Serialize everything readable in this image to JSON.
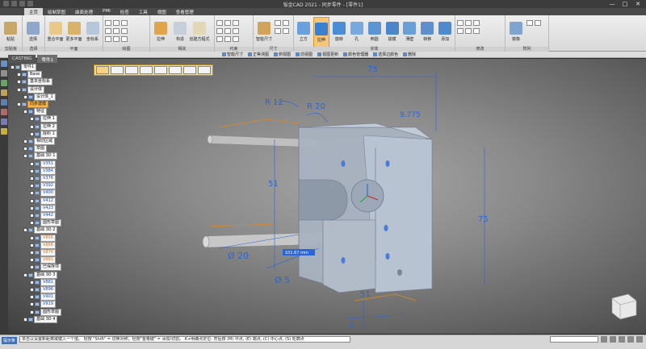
{
  "app": {
    "title": "钣金CAD 2021 - 同步零件 - [零件1]",
    "window_controls": [
      "—",
      "□",
      "✕"
    ]
  },
  "ribbon_tabs": [
    "主页",
    "绘制草图",
    "曲面处理",
    "PMI",
    "检查",
    "工具",
    "视图",
    "查看管理"
  ],
  "ribbon_groups": [
    {
      "label": "剪贴板",
      "big": [
        "粘贴"
      ]
    },
    {
      "label": "选择",
      "big": [
        "选择"
      ]
    },
    {
      "label": "平面",
      "big": [
        "重合平面",
        "更多平面",
        "坐标系"
      ]
    },
    {
      "label": "绘图",
      "big": []
    },
    {
      "label": "相关",
      "big": [
        "拉伸",
        "构造",
        "创建方程式"
      ]
    },
    {
      "label": "约束",
      "big": []
    },
    {
      "label": "尺寸",
      "big": [
        "智能尺寸"
      ]
    },
    {
      "label": "实体",
      "big": [
        "立方",
        "拉伸",
        "旋转",
        "孔",
        "倒圆",
        "拔模",
        "薄壁",
        "转移",
        "添加"
      ]
    },
    {
      "label": "修改",
      "big": []
    },
    {
      "label": "阵列",
      "big": [
        "镜像"
      ]
    }
  ],
  "strip_buttons": [
    "智能尺寸",
    "正等测图",
    "俯视图",
    "前视图",
    "视图更新",
    "颜色管理器",
    "选择边颜色",
    "删除"
  ],
  "document_tabs": [
    "CASTING",
    "零件1"
  ],
  "tree": [
    {
      "label": "零件1",
      "depth": 0,
      "style": "plain"
    },
    {
      "label": "Base",
      "depth": 1,
      "style": "plain"
    },
    {
      "label": "基本坐标系",
      "depth": 1,
      "style": "plain"
    },
    {
      "label": "设计体",
      "depth": 1,
      "style": "plain"
    },
    {
      "label": "设计体_1",
      "depth": 2,
      "style": "plain"
    },
    {
      "label": "同步建模",
      "depth": 1,
      "style": "orange"
    },
    {
      "label": "特征",
      "depth": 2,
      "style": "plain"
    },
    {
      "label": "拉伸 1",
      "depth": 3,
      "style": "plain"
    },
    {
      "label": "拉伸 2",
      "depth": 3,
      "style": "plain"
    },
    {
      "label": "除料 1",
      "depth": 3,
      "style": "plain"
    },
    {
      "label": "相切区域",
      "depth": 2,
      "style": "plain"
    },
    {
      "label": "草图",
      "depth": 2,
      "style": "plain"
    },
    {
      "label": "基础 3D 1",
      "depth": 2,
      "style": "plain"
    },
    {
      "label": "V351",
      "depth": 3,
      "style": "blue"
    },
    {
      "label": "V384",
      "depth": 3,
      "style": "blue"
    },
    {
      "label": "V376",
      "depth": 3,
      "style": "blue"
    },
    {
      "label": "V392",
      "depth": 3,
      "style": "blue"
    },
    {
      "label": "V400",
      "depth": 3,
      "style": "blue"
    },
    {
      "label": "V412",
      "depth": 3,
      "style": "blue"
    },
    {
      "label": "V423",
      "depth": 3,
      "style": "blue"
    },
    {
      "label": "V442",
      "depth": 3,
      "style": "blue"
    },
    {
      "label": "圆形草图",
      "depth": 3,
      "style": "plain"
    },
    {
      "label": "基础 3D 2",
      "depth": 2,
      "style": "plain"
    },
    {
      "label": "V856",
      "depth": 3,
      "style": "orangetext"
    },
    {
      "label": "V868",
      "depth": 3,
      "style": "orangetext"
    },
    {
      "label": "V874",
      "depth": 3,
      "style": "orangetext"
    },
    {
      "label": "V881",
      "depth": 3,
      "style": "orangetext"
    },
    {
      "label": "已保存项",
      "depth": 3,
      "style": "plain"
    },
    {
      "label": "基础 3D 3",
      "depth": 2,
      "style": "plain"
    },
    {
      "label": "V881",
      "depth": 3,
      "style": "blue"
    },
    {
      "label": "V896",
      "depth": 3,
      "style": "blue"
    },
    {
      "label": "V901",
      "depth": 3,
      "style": "blue"
    },
    {
      "label": "V919",
      "depth": 3,
      "style": "blue"
    },
    {
      "label": "圆形草图",
      "depth": 3,
      "style": "plain"
    },
    {
      "label": "基础 3D 4",
      "depth": 2,
      "style": "plain"
    }
  ],
  "dimensions": {
    "top_width": "75",
    "radius_large": "R 20",
    "radius_small": "R 12",
    "offset": "9.775",
    "height_left": "51",
    "height_right": "75",
    "dia_large": "Ø 20",
    "dia_small": "Ø 5",
    "bottom": "51",
    "live_value": "101.67 mm",
    "bottom_small": "5"
  },
  "status": {
    "label": "提示条",
    "message": "单击以设置新距离或键入一个值。 轻按 \"Shift\" = 切换对称；轻按\"金格键\" = 添加/切割。 K+明确点定位: 然后按 (M) 中点, (E) 端点, (C) 中心点, (S) 轮廓点"
  },
  "colors": {
    "accent": "#f7b347",
    "dimension": "#2a66d9",
    "sketch": "#e08a1a",
    "viewport_center": "#a6a6a6"
  }
}
